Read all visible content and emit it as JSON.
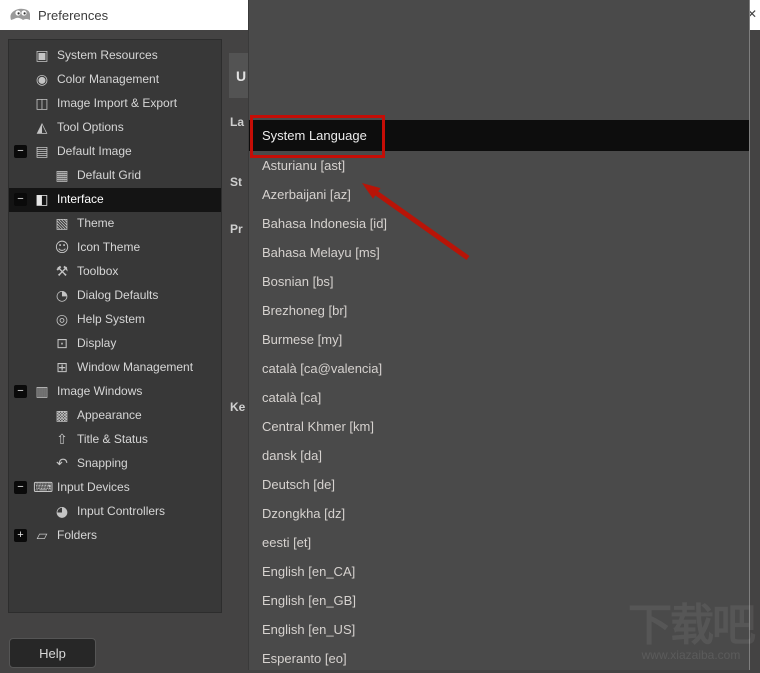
{
  "window": {
    "title": "Preferences",
    "close_glyph": "✕"
  },
  "sidebar": {
    "items": [
      {
        "label": "System Resources",
        "icon": "system-resources-icon",
        "glyph": "▣",
        "depth": 0,
        "expander": null,
        "selected": false
      },
      {
        "label": "Color Management",
        "icon": "color-management-icon",
        "glyph": "◉",
        "depth": 0,
        "expander": null,
        "selected": false
      },
      {
        "label": "Image Import & Export",
        "icon": "image-import-export-icon",
        "glyph": "◫",
        "depth": 0,
        "expander": null,
        "selected": false
      },
      {
        "label": "Tool Options",
        "icon": "tool-options-icon",
        "glyph": "◭",
        "depth": 0,
        "expander": null,
        "selected": false
      },
      {
        "label": "Default Image",
        "icon": "default-image-icon",
        "glyph": "▤",
        "depth": 0,
        "expander": "minus",
        "selected": false
      },
      {
        "label": "Default Grid",
        "icon": "default-grid-icon",
        "glyph": "▦",
        "depth": 1,
        "expander": null,
        "selected": false
      },
      {
        "label": "Interface",
        "icon": "interface-icon",
        "glyph": "◧",
        "depth": 0,
        "expander": "minus",
        "selected": true
      },
      {
        "label": "Theme",
        "icon": "theme-icon",
        "glyph": "▧",
        "depth": 1,
        "expander": null,
        "selected": false
      },
      {
        "label": "Icon Theme",
        "icon": "icon-theme-icon",
        "glyph": "☺",
        "depth": 1,
        "expander": null,
        "selected": false
      },
      {
        "label": "Toolbox",
        "icon": "toolbox-icon",
        "glyph": "⚒",
        "depth": 1,
        "expander": null,
        "selected": false
      },
      {
        "label": "Dialog Defaults",
        "icon": "dialog-defaults-icon",
        "glyph": "◔",
        "depth": 1,
        "expander": null,
        "selected": false
      },
      {
        "label": "Help System",
        "icon": "help-system-icon",
        "glyph": "◎",
        "depth": 1,
        "expander": null,
        "selected": false
      },
      {
        "label": "Display",
        "icon": "display-icon",
        "glyph": "⊡",
        "depth": 1,
        "expander": null,
        "selected": false
      },
      {
        "label": "Window Management",
        "icon": "window-management-icon",
        "glyph": "⊞",
        "depth": 1,
        "expander": null,
        "selected": false
      },
      {
        "label": "Image Windows",
        "icon": "image-windows-icon",
        "glyph": "▥",
        "depth": 0,
        "expander": "minus",
        "selected": false
      },
      {
        "label": "Appearance",
        "icon": "appearance-icon",
        "glyph": "▩",
        "depth": 1,
        "expander": null,
        "selected": false
      },
      {
        "label": "Title & Status",
        "icon": "title-status-icon",
        "glyph": "⇧",
        "depth": 1,
        "expander": null,
        "selected": false
      },
      {
        "label": "Snapping",
        "icon": "snapping-icon",
        "glyph": "↶",
        "depth": 1,
        "expander": null,
        "selected": false
      },
      {
        "label": "Input Devices",
        "icon": "input-devices-icon",
        "glyph": "⌨",
        "depth": 0,
        "expander": "minus",
        "selected": false
      },
      {
        "label": "Input Controllers",
        "icon": "input-controllers-icon",
        "glyph": "◕",
        "depth": 1,
        "expander": null,
        "selected": false
      },
      {
        "label": "Folders",
        "icon": "folders-icon",
        "glyph": "▱",
        "depth": 0,
        "expander": "plus",
        "selected": false
      }
    ],
    "expander_minus": "−",
    "expander_plus": "+"
  },
  "main": {
    "heading_partial": "U",
    "label_partials": [
      "La",
      "St",
      "Pr",
      "Ke"
    ]
  },
  "language_dropdown": {
    "selected": "System Language",
    "options": [
      "System Language",
      "Asturianu [ast]",
      "Azerbaijani [az]",
      "Bahasa Indonesia [id]",
      "Bahasa Melayu [ms]",
      "Bosnian [bs]",
      "Brezhoneg [br]",
      "Burmese [my]",
      "català [ca@valencia]",
      "català [ca]",
      "Central Khmer [km]",
      "dansk [da]",
      "Deutsch [de]",
      "Dzongkha [dz]",
      "eesti [et]",
      "English [en_CA]",
      "English [en_GB]",
      "English [en_US]",
      "Esperanto [eo]"
    ]
  },
  "annotations": {
    "red_color": "#c50d06",
    "box_target": "System Language",
    "arrow_target": "Azerbaijani [az]"
  },
  "footer": {
    "help_label": "Help"
  },
  "watermark": {
    "logo": "下载吧",
    "url": "www.xiazaiba.com"
  },
  "colors": {
    "titlebar_bg": "#ffffff",
    "dialog_bg": "#444343",
    "sidebar_bg": "#383838",
    "selection_bg": "#0d0d0d",
    "dropdown_bg": "#4a4a4a"
  }
}
